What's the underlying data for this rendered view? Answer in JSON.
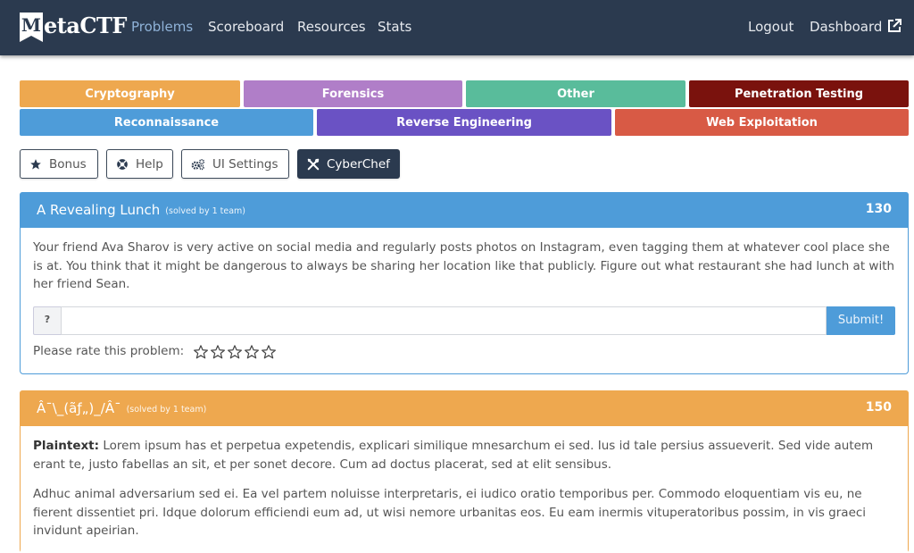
{
  "brand": {
    "logo_initial": "M",
    "logo_rest": "etaCTF"
  },
  "nav": {
    "problems": "Problems",
    "scoreboard": "Scoreboard",
    "resources": "Resources",
    "stats": "Stats",
    "logout": "Logout",
    "dashboard": "Dashboard"
  },
  "categories": [
    {
      "label": "Cryptography",
      "color": "#eea84f"
    },
    {
      "label": "Forensics",
      "color": "#b07ec8"
    },
    {
      "label": "Other",
      "color": "#59bc9b"
    },
    {
      "label": "Penetration Testing",
      "color": "#7a120d"
    },
    {
      "label": "Reconnaissance",
      "color": "#4e9cd9"
    },
    {
      "label": "Reverse Engineering",
      "color": "#6a52c4"
    },
    {
      "label": "Web Exploitation",
      "color": "#d85a45"
    }
  ],
  "tools": {
    "bonus": "Bonus",
    "help": "Help",
    "ui_settings": "UI Settings",
    "cyberchef": "CyberChef"
  },
  "problems": [
    {
      "title": "A Revealing Lunch",
      "solved": "(solved by 1 team)",
      "points": "130",
      "color": "#4e9cd9",
      "description": "Your friend Ava Sharov is very active on social media and regularly posts photos on Instagram, even tagging them at whatever cool place she is at. You think that it might be dangerous to always be sharing her location like that publicly. Figure out what restaurant she had lunch at with her friend Sean.",
      "answer_addon": "?",
      "answer_value": "",
      "answer_placeholder": "",
      "submit_label": "Submit!",
      "rate_label": "Please rate this problem:"
    },
    {
      "title": "Â¯\\_(ãƒ„)_/Â¯",
      "solved": "(solved by 1 team)",
      "points": "150",
      "color": "#eea84f",
      "plaintext_label": "Plaintext:",
      "paragraph1": " Lorem ipsum has et perpetua expetendis, explicari similique mnesarchum ei sed. Ius id tale persius assueverit. Sed vide autem erant te, justo fabellas an sit, et per sonet decore. Cum ad doctus placerat, sed at elit sensibus.",
      "paragraph2": "Adhuc animal adversarium sed ei. Ea vel partem noluisse interpretaris, ei iudico oratio temporibus per. Commodo eloquentiam vis eu, ne fierent dissentiet pri. Idque dolorum efficiendi eum ad, ut wisi nemore urbanitas eos. Eu eam inermis vituperatoribus possim, in vis graeci invidunt apeirian."
    }
  ],
  "icons": {
    "bonus": "star-icon",
    "help": "life-ring-icon",
    "ui_settings": "gears-icon",
    "cyberchef": "tools-icon",
    "dashboard": "external-link-icon",
    "rating": "star-outline-icon"
  },
  "theme": {
    "navbar": "#2b3a4f",
    "active_link": "#8fb2d8",
    "submit": "#4e9cd9"
  }
}
